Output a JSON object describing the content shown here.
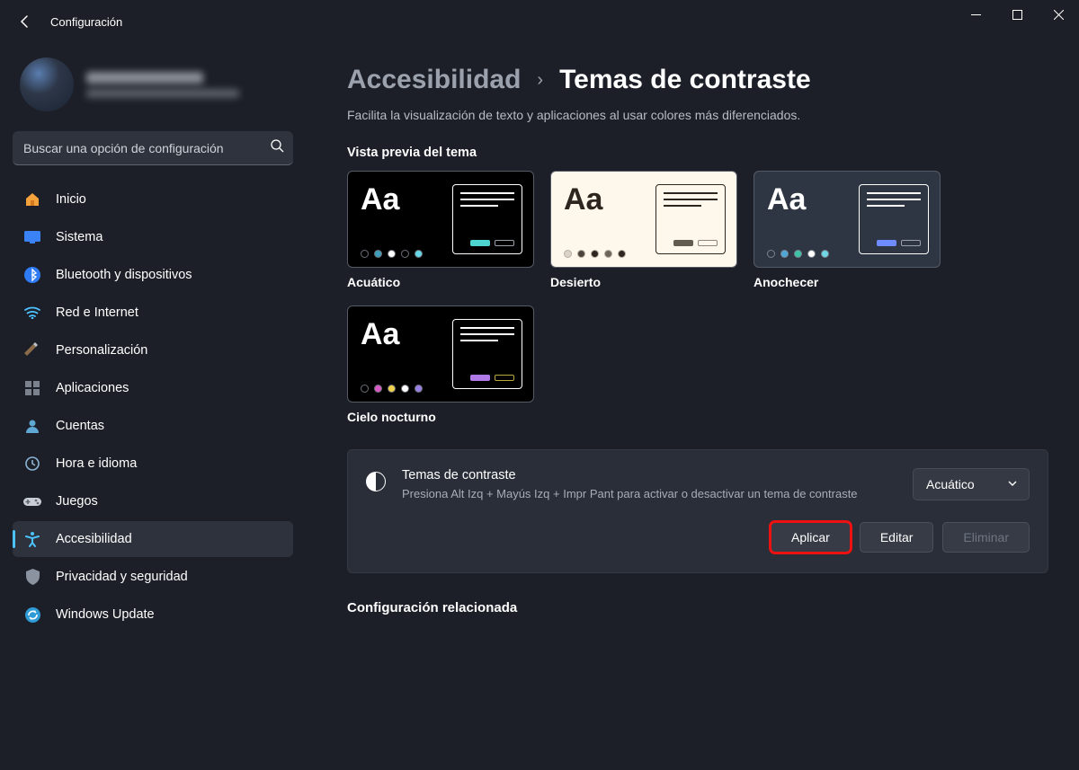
{
  "app_title": "Configuración",
  "search": {
    "placeholder": "Buscar una opción de configuración"
  },
  "nav": [
    {
      "label": "Inicio",
      "icon": "home"
    },
    {
      "label": "Sistema",
      "icon": "system"
    },
    {
      "label": "Bluetooth y dispositivos",
      "icon": "bt"
    },
    {
      "label": "Red e Internet",
      "icon": "net"
    },
    {
      "label": "Personalización",
      "icon": "pers"
    },
    {
      "label": "Aplicaciones",
      "icon": "apps"
    },
    {
      "label": "Cuentas",
      "icon": "acct"
    },
    {
      "label": "Hora e idioma",
      "icon": "time"
    },
    {
      "label": "Juegos",
      "icon": "games"
    },
    {
      "label": "Accesibilidad",
      "icon": "a11y",
      "selected": true
    },
    {
      "label": "Privacidad y seguridad",
      "icon": "priv"
    },
    {
      "label": "Windows Update",
      "icon": "wu"
    }
  ],
  "breadcrumb": {
    "parent": "Accesibilidad",
    "current": "Temas de contraste"
  },
  "description": "Facilita la visualización de texto y aplicaciones al usar colores más diferenciados.",
  "preview_heading": "Vista previa del tema",
  "themes": [
    {
      "label": "Acuático",
      "bg": "#000000",
      "fg": "#ffffff",
      "panel_border": "#ffffff",
      "line": "#ffffff",
      "dots": [
        "#000000",
        "#3e9db8",
        "#ffffff",
        "#000000",
        "#67d6e6"
      ],
      "dot_border": "#6b6f77",
      "btn1": "#4fd5d0",
      "btn2_border": "#9aa0aa"
    },
    {
      "label": "Desierto",
      "bg": "#fdf7ec",
      "fg": "#2d2620",
      "panel_border": "#2d2620",
      "line": "#2d2620",
      "dots": [
        "#d9d2c6",
        "#4b443c",
        "#2d2620",
        "#6b645a",
        "#2d2620"
      ],
      "dot_border": "#b6af9f",
      "btn1": "#625b51",
      "btn2_border": "#8d8578"
    },
    {
      "label": "Anochecer",
      "bg": "#2d3642",
      "fg": "#ffffff",
      "panel_border": "#ffffff",
      "line": "#ffffff",
      "dots": [
        "#2d3642",
        "#4fa7d6",
        "#3cc2a6",
        "#ffffff",
        "#6fd7e6"
      ],
      "dot_border": "#7a828e",
      "btn1": "#6f8cff",
      "btn2_border": "#9aa0aa"
    },
    {
      "label": "Cielo nocturno",
      "bg": "#000000",
      "fg": "#ffffff",
      "panel_border": "#ffffff",
      "line": "#ffffff",
      "dots": [
        "#000000",
        "#d95ac6",
        "#f0d24a",
        "#ffffff",
        "#9a7fe6"
      ],
      "dot_border": "#6b6f77",
      "btn1": "#b07ae6",
      "btn2_border": "#b9a93a"
    }
  ],
  "card": {
    "title": "Temas de contraste",
    "subtitle": "Presiona Alt Izq + Mayús Izq + Impr Pant para activar o desactivar un tema de contraste",
    "selected": "Acuático",
    "apply": "Aplicar",
    "edit": "Editar",
    "delete": "Eliminar"
  },
  "related_heading": "Configuración relacionada"
}
